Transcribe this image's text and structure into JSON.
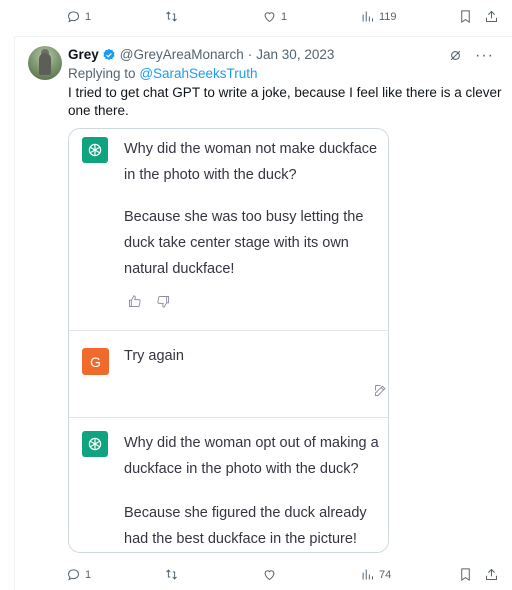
{
  "top_actions": {
    "reply_count": "1",
    "retweet_count": "",
    "like_count": "1",
    "views_count": "119"
  },
  "tweet": {
    "display_name": "Grey",
    "handle": "@GreyAreaMonarch",
    "separator": "·",
    "date": "Jan 30, 2023",
    "replying_prefix": "Replying to",
    "replying_to": "@SarahSeeksTruth",
    "text": "I tried to get chat GPT to write a joke, because I feel like there is a clever one there."
  },
  "chat": {
    "q1": "Why did the woman not make duckface in the photo with the duck?",
    "a1": "Because she was too busy letting the duck take center stage with its own natural duckface!",
    "user_initial": "G",
    "user_msg": "Try again",
    "q2": "Why did the woman opt out of making a duckface in the photo with the duck?",
    "a2": "Because she figured the duck already had the best duckface in the picture!"
  },
  "bottom_actions": {
    "reply_count": "1",
    "retweet_count": "",
    "like_count": "",
    "views_count": "74"
  },
  "colors": {
    "accent": "#1d9bf0",
    "gpt_green": "#10a37f",
    "user_orange": "#f06a2c",
    "muted": "#536471"
  }
}
